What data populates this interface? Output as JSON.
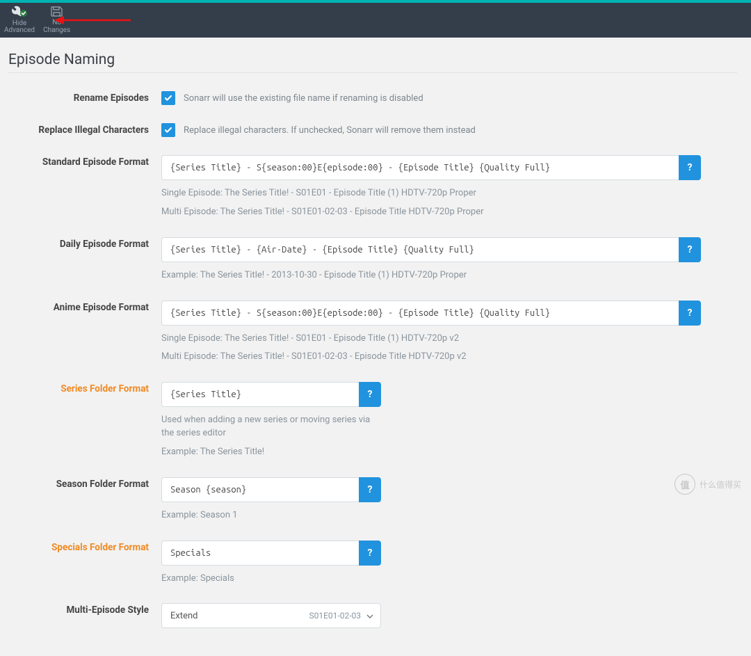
{
  "toolbar": {
    "hide_advanced": {
      "line1": "Hide",
      "line2": "Advanced"
    },
    "no_changes": {
      "line1": "No",
      "line2": "Changes"
    }
  },
  "page_title": "Episode Naming",
  "rename_episodes": {
    "label": "Rename Episodes",
    "help": "Sonarr will use the existing file name if renaming is disabled"
  },
  "replace_illegal": {
    "label": "Replace Illegal Characters",
    "help": "Replace illegal characters. If unchecked, Sonarr will remove them instead"
  },
  "standard_format": {
    "label": "Standard Episode Format",
    "value": "{Series Title} - S{season:00}E{episode:00} - {Episode Title} {Quality Full}",
    "hint1": "Single Episode: The Series Title! - S01E01 - Episode Title (1) HDTV-720p Proper",
    "hint2": "Multi Episode: The Series Title! - S01E01-02-03 - Episode Title HDTV-720p Proper",
    "help": "?"
  },
  "daily_format": {
    "label": "Daily Episode Format",
    "value": "{Series Title} - {Air-Date} - {Episode Title} {Quality Full}",
    "hint1": "Example: The Series Title! - 2013-10-30 - Episode Title (1) HDTV-720p Proper",
    "help": "?"
  },
  "anime_format": {
    "label": "Anime Episode Format",
    "value": "{Series Title} - S{season:00}E{episode:00} - {Episode Title} {Quality Full}",
    "hint1": "Single Episode: The Series Title! - S01E01 - Episode Title (1) HDTV-720p v2",
    "hint2": "Multi Episode: The Series Title! - S01E01-02-03 - Episode Title HDTV-720p v2",
    "help": "?"
  },
  "series_folder": {
    "label": "Series Folder Format",
    "value": "{Series Title}",
    "hint1": "Used when adding a new series or moving series via the series editor",
    "hint2": "Example: The Series Title!",
    "help": "?"
  },
  "season_folder": {
    "label": "Season Folder Format",
    "value": "Season {season}",
    "hint1": "Example: Season 1",
    "help": "?"
  },
  "specials_folder": {
    "label": "Specials Folder Format",
    "value": "Specials",
    "hint1": "Example: Specials",
    "help": "?"
  },
  "multi_episode": {
    "label": "Multi-Episode Style",
    "value": "Extend",
    "suffix": "S01E01-02-03"
  },
  "watermark": "什么值得买"
}
